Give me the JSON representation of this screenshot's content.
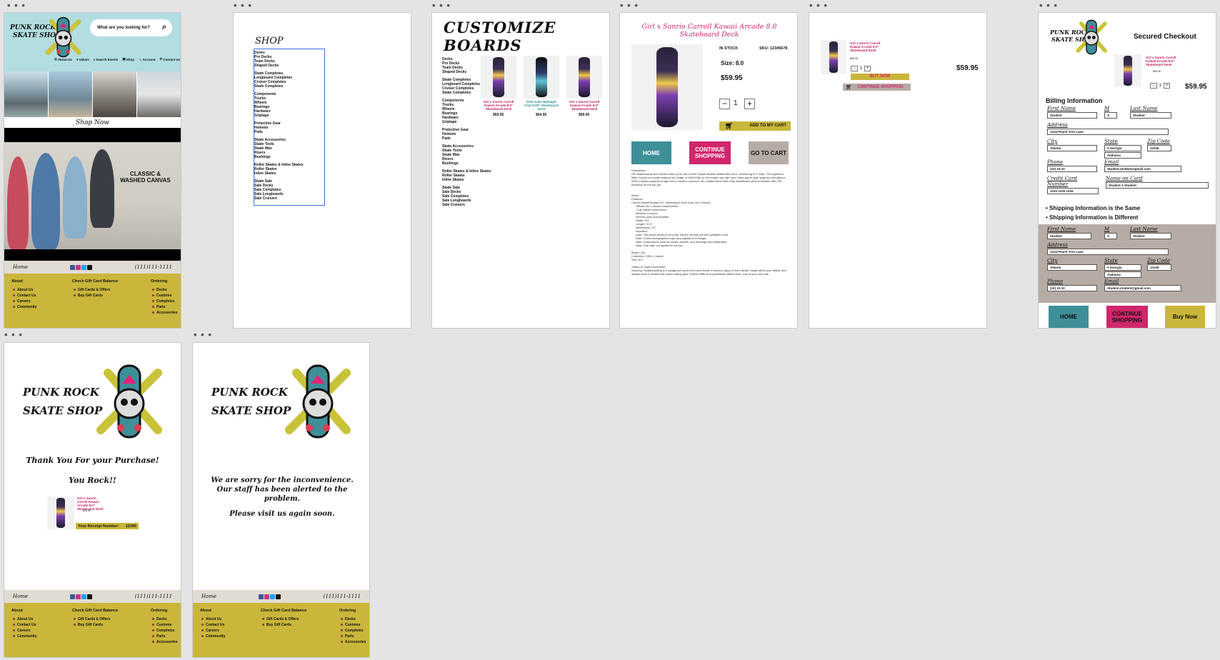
{
  "brand": {
    "logo_line1": "PUNK ROCK",
    "logo_line2": "SKATE SHOP",
    "colors": {
      "header_bg": "#b2dde1",
      "footer_bg": "#c9b63a",
      "teal": "#3e8f98",
      "pink": "#d0266b",
      "taupe": "#b7aca5"
    }
  },
  "home": {
    "search_placeholder": "What are you looking for?",
    "nav": [
      "About Us",
      "Values",
      "Search Events",
      "Shop",
      "Account",
      "Contact Us"
    ],
    "shop_now": "Shop Now",
    "hero_text1": "CLASSIC &",
    "hero_text2": "WASHED CANVAS"
  },
  "common_bar": {
    "home": "Home",
    "phone": "(111)111-1111"
  },
  "footer": {
    "about_title": "About",
    "about_items": [
      "About Us",
      "Contact Us",
      "Careers",
      "Community"
    ],
    "gift_title": "Check Gift Card Balance",
    "gift_items": [
      "Gift Cards & Offers",
      "Buy Gift Cards"
    ],
    "order_title": "Ordering",
    "order_items": [
      "Decks",
      "Customs",
      "Completes",
      "Parts",
      "Accessories"
    ]
  },
  "shop": {
    "title": "SHOP",
    "groups": [
      [
        "Decks",
        "Pro Decks",
        "Team Decks",
        "Shaped Decks"
      ],
      [
        "Skate Completes",
        "Longboard Completes",
        "Cruiser Completes",
        "Skate Completes"
      ],
      [
        "Components",
        "Trucks",
        "Wheels",
        "Bearings",
        "Hardware",
        "Griptape"
      ],
      [
        "Protective Gear",
        "Helmets",
        "Pads"
      ],
      [
        "Skate Accessories",
        "Skate Tools",
        "Skate Wax",
        "Risers",
        "Bushings"
      ],
      [
        "Roller Skates & Inline Skates",
        "Roller Skates",
        "Inline Skates"
      ],
      [
        "Skate Sale",
        "Sale Decks",
        "Sale Completes",
        "Sale Longboards",
        "Sale Cruisers"
      ]
    ]
  },
  "customize": {
    "title": "CUSTOMIZE BOARDS",
    "products": [
      {
        "name": "Girl x Sanrio Carroll Kawaii Arcade 8.0\" Skateboard Deck",
        "price": "$59.95"
      },
      {
        "name": "DGK Kalis Midnight Club 8.06\" Skateboard Deck",
        "price": "$64.95"
      },
      {
        "name": "Girl x Sanrio Carroll Kawaii Arcade 8.0\" Skateboard Deck",
        "price": "$59.95"
      }
    ]
  },
  "product": {
    "title": "Girl x Sanrio Carroll Kawaii Arcade 8.0 Skateboard Deck",
    "stock": "IN STOCK",
    "sku": "SKU: 12345678",
    "size": "Size: 8.0",
    "price": "$59.95",
    "qty": "1",
    "add_to_cart": "ADD TO MY CART",
    "home": "HOME",
    "continue": "CONTINUE SHOPPING",
    "go_cart": "GO TO CART",
    "desc_heading": "Description",
    "desc": "Girl Skateboards and Sanrio team up for the Carroll Kawaii Arcade skateboard deck, measuring 8.0\" wide. The signature Mike Carroll pro model features an image of Hello Kitty on the bottom ply, with retro video game style graphics throughout. With a classic popsicle shape and a medium concave, the collaborative Hello Kitty skateboard deck is finished with Girl branding on the top ply.",
    "about_heading": "About",
    "features_heading": "Features",
    "features_intro": "Carroll Kawaii Arcade 8.0\" Skateboard Deck from Girl x Sanrio.",
    "features": [
      "Official Girl x Sanrio collaboration.",
      "7-ply maple construction.",
      "Medium concave.",
      "Pitched nose and kicktails.",
      "Width: 8.0\"",
      "Length: 31.5\"",
      "Wheelbase: 14\"",
      "Imported.",
      "Note: Top sheet comes in any and Sanrio will ship the first available color.",
      "Note: Colors and graphics may vary slightly from image.",
      "Note: components such as trucks, wheels, and bearings sold separately.",
      "Note: Grip tape not applied to the top."
    ],
    "brand": "Brand: Girl",
    "collection": "Collection: GIRL x Sanrio",
    "size2": "Size: 8.0",
    "safety_heading": "Safety & Legal Information",
    "safety": "Warning: Skateboarding is a dangerous sport and could result in serious injury or even death. Skate within your ability, and always wear a helmet and proper safety gear. Follow traffic and pedestrian safety rules. Use at your own risk."
  },
  "cart": {
    "item": "Girl x Sanrio Carroll Kawaii Arcade 8.0\" Skateboard Deck",
    "price": "$59.95",
    "qty": "1",
    "buy_now": "BUY NOW",
    "continue": "CONTINUE SHOPPING"
  },
  "checkout": {
    "title": "Secured Checkout",
    "item": "Girl x Sanrio Carroll Kawaii Arcade 8.0\" Skateboard Deck",
    "item_price": "$59.95",
    "total": "$59.95",
    "qty": "1",
    "billing": "Billing Information",
    "labels": {
      "first": "First Name",
      "mi": "M",
      "last": "Last Name",
      "address": "Address",
      "city": "City",
      "state": "State",
      "zip": "Zip Code",
      "phone": "Phone",
      "email": "Email",
      "cc": "Credit Card Number",
      "name_card": "Name on Card"
    },
    "values": {
      "first": "Student",
      "mi": "A",
      "last": "Student",
      "address": "1234 Peach Tree Lane",
      "city": "Atlanta",
      "state": "Georgia",
      "state2": "Alabama",
      "zip": "12345",
      "phone": "(10) 10-10",
      "email": "Student.student@gmail.com",
      "cc": "1234 1234 1234",
      "name_card": "Student A Student"
    },
    "ship_same": "Shipping Information is the Same",
    "ship_diff": "Shipping Information is Different",
    "home": "HOME",
    "continue": "CONTINUE SHOPPING",
    "buy": "Buy Now"
  },
  "thanks": {
    "line1": "Thank You For your Purchase!",
    "line2": "You Rock!!",
    "receipt_label": "Your Receipt Number:",
    "receipt": "12345",
    "item": "Girl x Sanrio Carroll Kawaii Arcade 8.0\" Skateboard Deck",
    "price": "$59.95"
  },
  "sorry": {
    "line1": "We are sorry for the inconvenience.",
    "line2": "Our staff has been alerted to the problem.",
    "line3": "Please visit us again soon."
  }
}
